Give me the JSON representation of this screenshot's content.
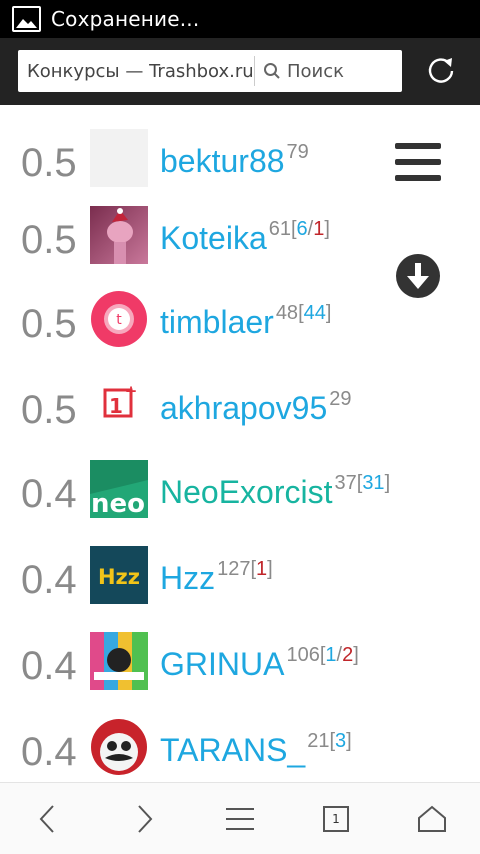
{
  "status": {
    "text": "Сохранение..."
  },
  "toolbar": {
    "url_text": "Конкурсы — Trashbox.ru",
    "search_label": "Поиск"
  },
  "rows": [
    {
      "score": "0.5",
      "name": "bektur88",
      "count": "79",
      "extra": []
    },
    {
      "score": "0.5",
      "name": "Koteika",
      "count": "61",
      "extra": [
        {
          "t": "[",
          "c": "gray"
        },
        {
          "t": "6",
          "c": "blue"
        },
        {
          "t": "/",
          "c": "gray"
        },
        {
          "t": "1",
          "c": "red"
        },
        {
          "t": "]",
          "c": "gray"
        }
      ]
    },
    {
      "score": "0.5",
      "name": "timblaer",
      "count": "48",
      "extra": [
        {
          "t": "[",
          "c": "gray"
        },
        {
          "t": "44",
          "c": "blue"
        },
        {
          "t": "]",
          "c": "gray"
        }
      ]
    },
    {
      "score": "0.5",
      "name": "akhrapov95",
      "count": "29",
      "extra": []
    },
    {
      "score": "0.4",
      "name": "NeoExorcist",
      "count": "37",
      "extra": [
        {
          "t": "[",
          "c": "gray"
        },
        {
          "t": "31",
          "c": "blue"
        },
        {
          "t": "]",
          "c": "gray"
        }
      ]
    },
    {
      "score": "0.4",
      "name": "Hzz",
      "count": "127",
      "extra": [
        {
          "t": "[",
          "c": "gray"
        },
        {
          "t": "1",
          "c": "red"
        },
        {
          "t": "]",
          "c": "gray"
        }
      ]
    },
    {
      "score": "0.4",
      "name": "GRINUA",
      "count": "106",
      "extra": [
        {
          "t": "[",
          "c": "gray"
        },
        {
          "t": "1",
          "c": "blue"
        },
        {
          "t": "/",
          "c": "gray"
        },
        {
          "t": "2",
          "c": "red"
        },
        {
          "t": "]",
          "c": "gray"
        }
      ]
    },
    {
      "score": "0.4",
      "name": "TARANS_",
      "count": "21",
      "extra": [
        {
          "t": "[",
          "c": "gray"
        },
        {
          "t": "3",
          "c": "blue"
        },
        {
          "t": "]",
          "c": "gray"
        }
      ]
    }
  ],
  "avatars": {
    "oneplus_text": "1+",
    "neo_text": "neo",
    "hzz_text": "Hzz",
    "timblaer_text": "t"
  },
  "bottom": {
    "tab_count": "1"
  },
  "colors": {
    "link": "#1ea7e0",
    "green_link": "#17b4a0",
    "red": "#c0262a",
    "gray": "#8a8a8a"
  }
}
